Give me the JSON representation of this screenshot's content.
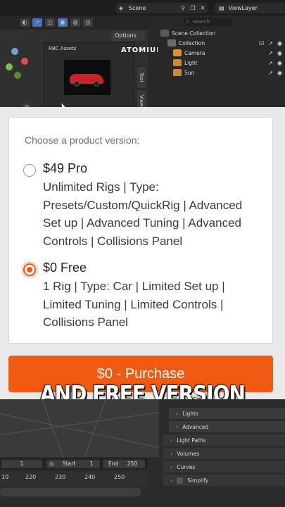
{
  "top": {
    "scene_label": "Scene",
    "viewlayer_label": "ViewLayer",
    "options_label": "Options",
    "asset_panel_title": "RBC Assets",
    "logo_text": "ATOMIUM",
    "side_tabs": [
      "Tool",
      "View"
    ],
    "search_placeholder": "Search",
    "outliner": {
      "rows": [
        {
          "label": "Scene Collection"
        },
        {
          "label": "Collection"
        },
        {
          "label": "Camera"
        },
        {
          "label": "Light"
        },
        {
          "label": "Sun"
        }
      ]
    }
  },
  "card": {
    "prompt": "Choose a product version:",
    "options": [
      {
        "title": "$49 Pro",
        "description": "Unlimited Rigs | Type: Presets/Custom/QuickRig | Advanced Set up | Advanced Tuning | Advanced Controls | Collisions Panel",
        "selected": false
      },
      {
        "title": "$0 Free",
        "description": "1 Rig | Type: Car | Limited Set up | Limited Tuning | Limited Controls | Collisions Panel",
        "selected": true
      }
    ],
    "purchase_label": "$0 - Purchase",
    "accent_color": "#f15a13"
  },
  "caption": "AND FREE VERSION",
  "bottom": {
    "timeline": {
      "frame": "1",
      "start_label": "Start",
      "start_value": "1",
      "end_label": "End",
      "end_value": "250",
      "ticks": [
        "10",
        "220",
        "230",
        "240",
        "250"
      ]
    },
    "properties": [
      {
        "label": "Lights",
        "sub": true
      },
      {
        "label": "Advanced",
        "sub": true
      },
      {
        "label": "Light Paths",
        "sub": false
      },
      {
        "label": "Volumes",
        "sub": false
      },
      {
        "label": "Curves",
        "sub": false
      },
      {
        "label": "Simplify",
        "sub": false
      }
    ]
  }
}
